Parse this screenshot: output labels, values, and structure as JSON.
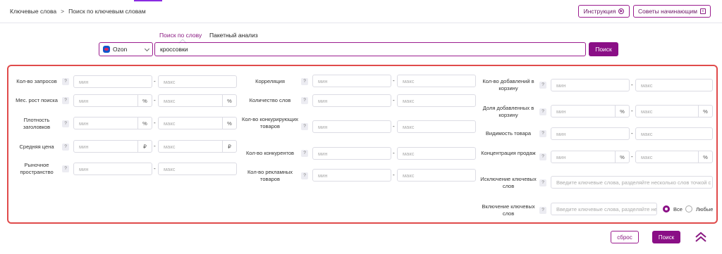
{
  "header": {
    "breadcrumb": [
      "Ключевые слова",
      "Поиск по ключевым словам"
    ],
    "breadcrumb_sep": ">",
    "btn_instruction": "Инструкция",
    "btn_tips": "Советы начинающим"
  },
  "tabs": {
    "by_word": "Поиск по слову",
    "batch": "Пакетный анализ",
    "active": "by_word"
  },
  "search": {
    "marketplace": "Ozon",
    "query": "кроссовки",
    "button": "Поиск"
  },
  "filters": {
    "min_ph": "мин",
    "max_ph": "макс",
    "dash": "-",
    "pct": "%",
    "rub": "₽",
    "help": "?",
    "col1": {
      "queries": "Кол-во запросов",
      "growth": "Мес. рост поиска",
      "density": "Плотность заголовков",
      "avg_price": "Средняя цена",
      "market_space": "Рыночное пространство"
    },
    "col2": {
      "correlation": "Корреляция",
      "word_count": "Количество слов",
      "competing_goods": "Кол-во конкурирующих товаров",
      "competitors": "Кол-во конкурентов",
      "ad_goods": "Кол-во рекламных товаров"
    },
    "col3": {
      "cart_adds": "Кол-во добавлений в корзину",
      "cart_share": "Доля добавленных в корзину",
      "visibility": "Видимость товара",
      "concentration": "Концентрация продаж",
      "exclude": "Исключение ключевых слов",
      "exclude_ph": "Введите ключевые слова, разделяйте несколько слов точкой с запятой",
      "include": "Включение ключевых слов",
      "include_ph": "Введите ключевые слова, разделяйте несколько слов точкой с запятой",
      "radio_all": "Все",
      "radio_any": "Любые",
      "radio_selected": "all"
    }
  },
  "footer": {
    "reset": "сброс",
    "search": "Поиск"
  }
}
